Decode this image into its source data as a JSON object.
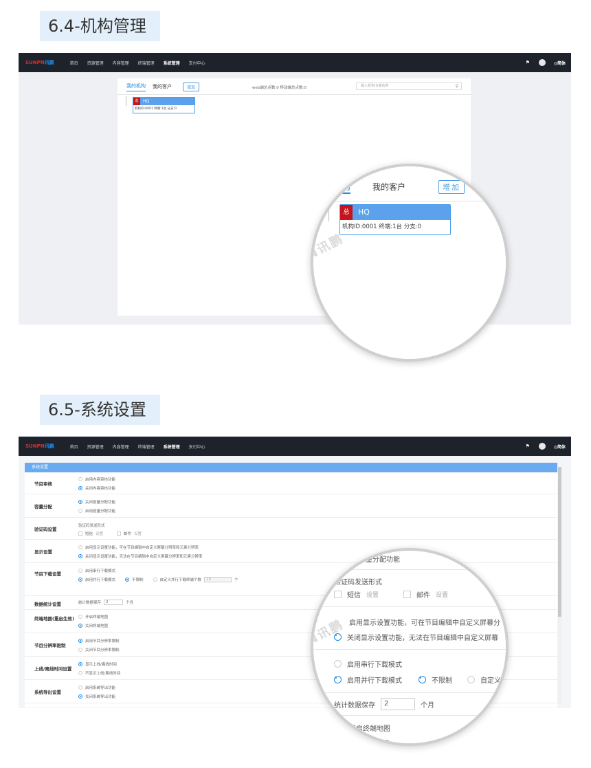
{
  "section1": {
    "title": "6.4-机构管理",
    "nav": {
      "logo_main": "SUNPN",
      "logo_sub": "讯鹏",
      "items": [
        "首页",
        "资源管理",
        "内容管理",
        "终端管理",
        "系统管理",
        "支付中心"
      ],
      "active_index": 4,
      "lang": "◎简体"
    },
    "org": {
      "tab_my_org": "我的机构",
      "tab_my_clients": "我的客户",
      "add_button": "增加",
      "stats": "web端总点数:0 移动端总点数:0",
      "search_placeholder": "输入机构ID或名称",
      "card_badge": "总",
      "card_name": "HQ",
      "card_info": "机构ID:0001  终端:1台  分支:0"
    },
    "zoom": {
      "tab_my_org_partial": "机构",
      "tab_my_clients": "我的客户",
      "add_button": "增加",
      "card_badge": "总",
      "card_name": "HQ",
      "card_info": "机构ID:0001  终端:1台  分支:0",
      "watermark": "SUNPN讯鹏"
    }
  },
  "section2": {
    "title": "6.5-系统设置",
    "header": "系统设置",
    "rows": [
      {
        "label": "节目审核",
        "options": [
          {
            "text": "启用内容审核功能",
            "checked": false
          },
          {
            "text": "关闭内容审核功能",
            "checked": true
          }
        ]
      },
      {
        "label": "容量分配",
        "options": [
          {
            "text": "关闭容量分配功能",
            "checked": true
          },
          {
            "text": "启用容量分配功能",
            "checked": false
          }
        ]
      },
      {
        "label": "验证码设置",
        "sub": "验证码发送形式",
        "sms": "短信",
        "email": "邮件",
        "setting": "设置"
      },
      {
        "label": "显示设置",
        "options": [
          {
            "text": "启用显示设置功能，可在节目编辑中自定义屏幕分辨率和元素分辨率",
            "checked": false
          },
          {
            "text": "关闭显示设置功能，无法在节目编辑中自定义屏幕分辨率和元素分辨率",
            "checked": true
          }
        ]
      },
      {
        "label": "节目下载设置",
        "serial": "启用串行下载模式",
        "parallel": "启用并行下载模式",
        "unlimited": "不限制",
        "custom": "自定义并行下载终端个数",
        "custom_value": "10",
        "unit": "个"
      },
      {
        "label": "数据统计设置",
        "text": "统计数据保存",
        "value": "2",
        "unit": "个月"
      },
      {
        "label": "终端地图(重启生效)",
        "options": [
          {
            "text": "开启终端地图",
            "checked": false
          },
          {
            "text": "关闭终端地图",
            "checked": true
          }
        ]
      },
      {
        "label": "节目分辨率限制",
        "options": [
          {
            "text": "启用节目分辨率限制",
            "checked": true
          },
          {
            "text": "关闭节目分辨率限制",
            "checked": false
          }
        ]
      },
      {
        "label": "上线/离线时间设置",
        "options": [
          {
            "text": "显示上线/离线时间",
            "checked": true
          },
          {
            "text": "不显示上线/离线时间",
            "checked": false
          }
        ]
      },
      {
        "label": "系统导出设置",
        "options": [
          {
            "text": "启用系统导出功能",
            "checked": false
          },
          {
            "text": "关闭系统导出功能",
            "checked": true
          }
        ]
      }
    ],
    "zoom": {
      "line1": "启容量分配功能",
      "line2": "验证码发送形式",
      "sms": "短信",
      "email": "邮件",
      "setting": "设置",
      "line3": "启用显示设置功能，可在节目编辑中自定义屏幕分",
      "line4": "关闭显示设置功能，无法在节目编辑中自定义屏幕",
      "line5": "启用串行下载模式",
      "line6": "启用并行下载模式",
      "line6b": "不限制",
      "line6c": "自定义并",
      "line7": "统计数据保存",
      "line7v": "2",
      "line7u": "个月",
      "line8": "开启终端地图",
      "line9": "终端地图",
      "watermark": "SUNPN讯鹏"
    }
  }
}
